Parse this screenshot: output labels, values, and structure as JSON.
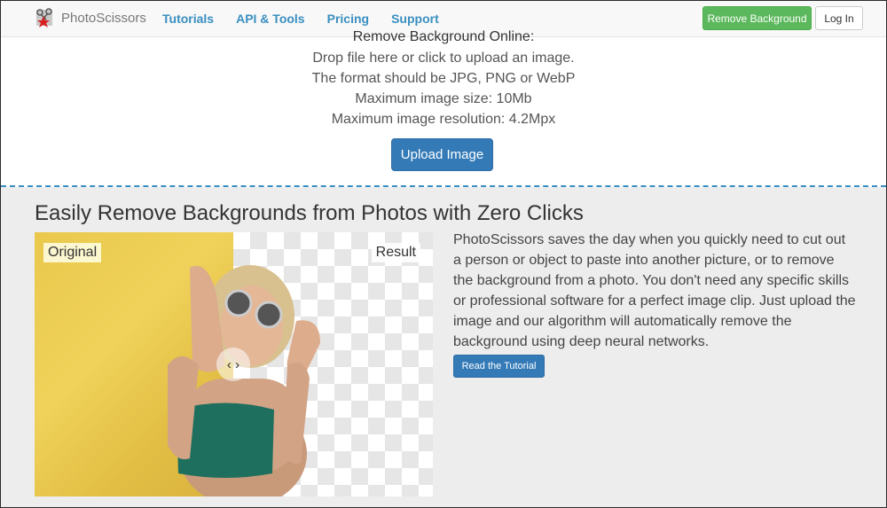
{
  "navbar": {
    "brand": "PhotoScissors",
    "links": [
      "Tutorials",
      "API & Tools",
      "Pricing",
      "Support"
    ],
    "remove_bg_button": "Remove Background",
    "login_button": "Log In"
  },
  "upload": {
    "title": "Remove Background Online:",
    "lines": [
      "Drop file here or click to upload an image.",
      "The format should be JPG, PNG or WebP",
      "Maximum image size: 10Mb",
      "Maximum image resolution: 4.2Mpx"
    ],
    "button": "Upload Image"
  },
  "feature": {
    "title": "Easily Remove Backgrounds from Photos with Zero Clicks",
    "label_original": "Original",
    "label_result": "Result",
    "handle_glyph": "‹ ›",
    "description": "PhotoScissors saves the day when you quickly need to cut out a person or object to paste into another picture, or to remove the background from a photo. You don't need any specific skills or professional software for a perfect image clip. Just upload the image and our algorithm will automatically remove the background using deep neural networks.",
    "tutorial_button": "Read the Tutorial"
  },
  "colors": {
    "link": "#3a8fc0",
    "green": "#5cb85c",
    "primary": "#337ab7",
    "section_bg": "#ededed"
  }
}
